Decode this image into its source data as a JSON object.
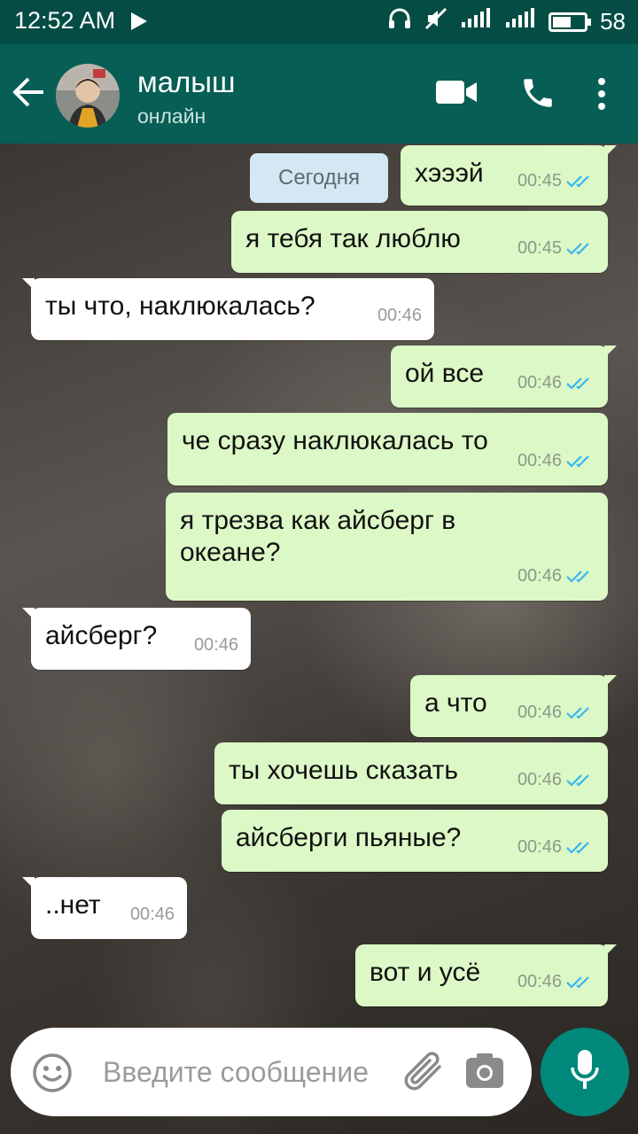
{
  "status_bar": {
    "time": "12:52 AM",
    "battery": "58",
    "battery_level": 0.58
  },
  "contact": {
    "name": "малыш",
    "status": "онлайн"
  },
  "date_chip": "Сегодня",
  "messages": [
    {
      "dir": "out",
      "text": "хэээй",
      "time": "00:45",
      "read": true
    },
    {
      "dir": "out",
      "text": "я тебя так люблю",
      "time": "00:45",
      "read": true
    },
    {
      "dir": "in",
      "text": "ты что, наклюкалась?",
      "time": "00:46"
    },
    {
      "dir": "out",
      "text": "ой все",
      "time": "00:46",
      "read": true
    },
    {
      "dir": "out",
      "text": "че сразу наклюкалась то",
      "time": "00:46",
      "read": true
    },
    {
      "dir": "out",
      "text": "я трезва как айсберг в океане?",
      "time": "00:46",
      "read": true
    },
    {
      "dir": "in",
      "text": "айсберг?",
      "time": "00:46"
    },
    {
      "dir": "out",
      "text": "а что",
      "time": "00:46",
      "read": true
    },
    {
      "dir": "out",
      "text": "ты хочешь сказать",
      "time": "00:46",
      "read": true
    },
    {
      "dir": "out",
      "text": "айсберги пьяные?",
      "time": "00:46",
      "read": true
    },
    {
      "dir": "in",
      "text": "..нет",
      "time": "00:46"
    },
    {
      "dir": "out",
      "text": "вот и усё",
      "time": "00:46",
      "read": true
    }
  ],
  "input": {
    "placeholder": "Введите сообщение"
  },
  "colors": {
    "header": "#075e54",
    "status_bar": "#054d44",
    "outgoing_bubble": "#dcf8c6",
    "incoming_bubble": "#ffffff",
    "read_ticks": "#34b7f1",
    "mic_button": "#00897b"
  },
  "icons": [
    "back-arrow-icon",
    "video-call-icon",
    "phone-icon",
    "more-vert-icon",
    "emoji-icon",
    "attach-icon",
    "camera-icon",
    "mic-icon",
    "play-icon",
    "headphones-icon",
    "mute-icon",
    "signal-icon",
    "battery-icon"
  ]
}
